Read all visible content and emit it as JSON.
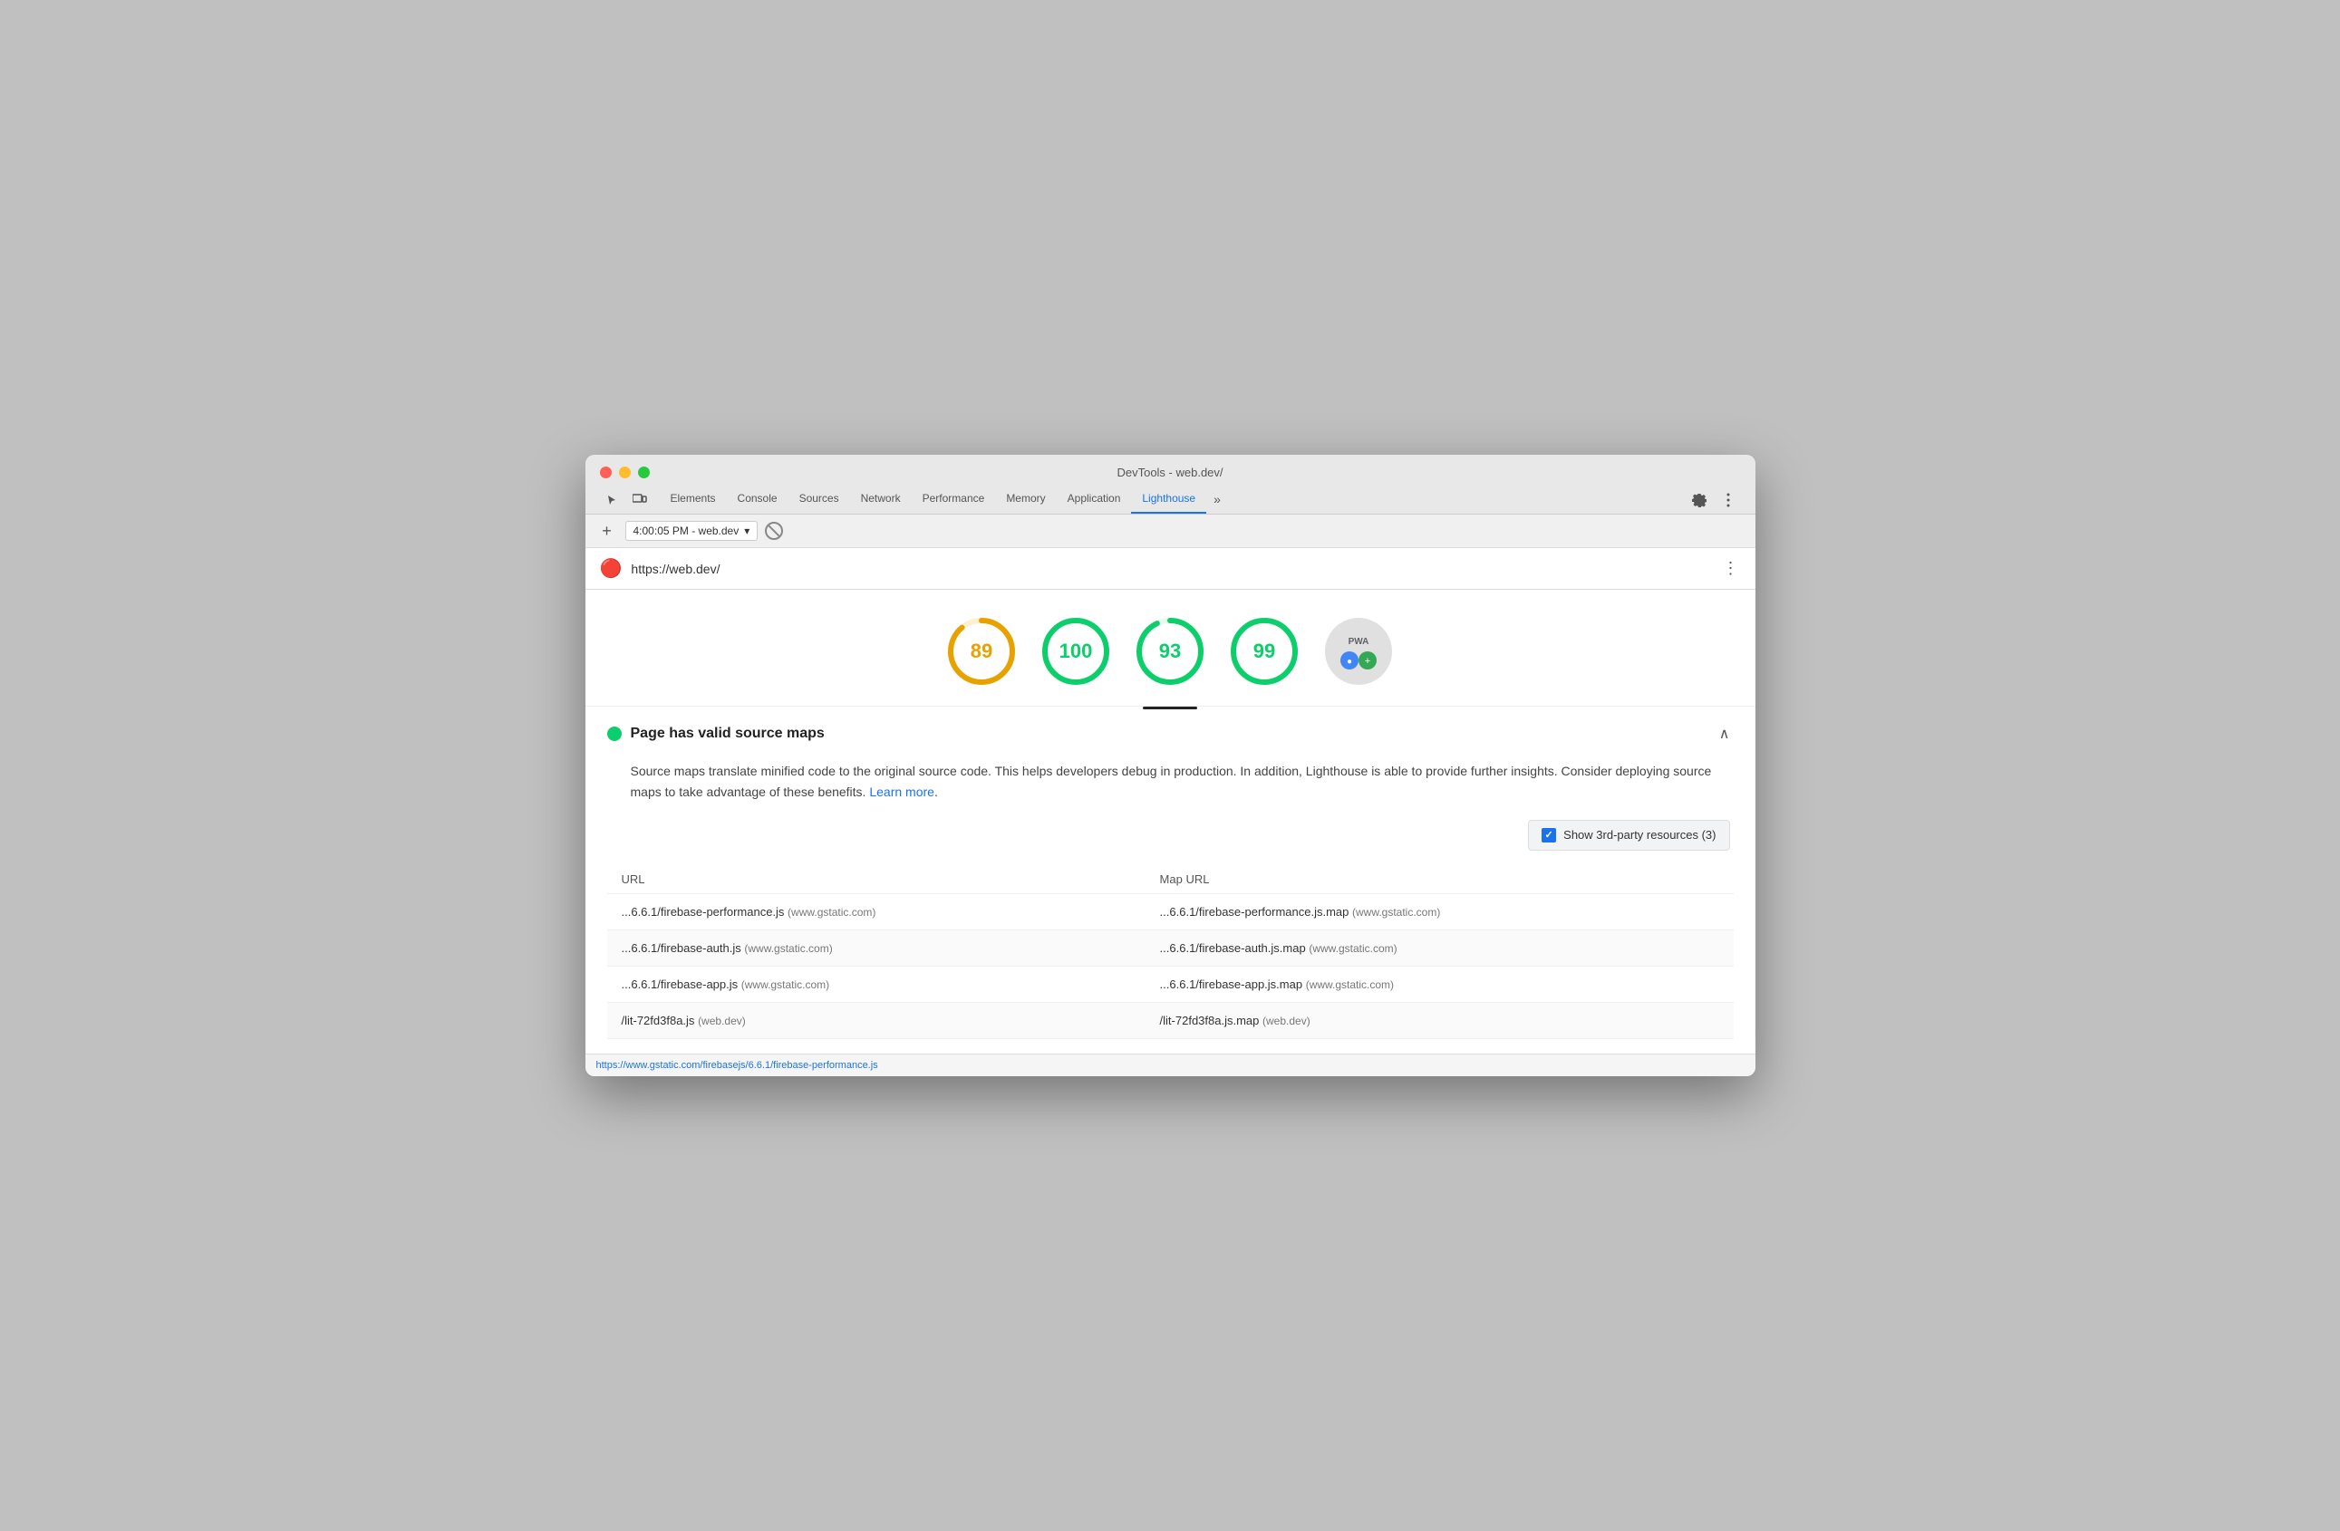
{
  "window": {
    "title": "DevTools - web.dev/"
  },
  "tabs": {
    "items": [
      {
        "id": "elements",
        "label": "Elements"
      },
      {
        "id": "console",
        "label": "Console"
      },
      {
        "id": "sources",
        "label": "Sources"
      },
      {
        "id": "network",
        "label": "Network"
      },
      {
        "id": "performance",
        "label": "Performance"
      },
      {
        "id": "memory",
        "label": "Memory"
      },
      {
        "id": "application",
        "label": "Application"
      },
      {
        "id": "lighthouse",
        "label": "Lighthouse",
        "active": true
      }
    ]
  },
  "toolbar": {
    "add_label": "+",
    "session_label": "4:00:05 PM - web.dev"
  },
  "url_bar": {
    "url": "https://web.dev/"
  },
  "scores": [
    {
      "id": "performance",
      "value": "89",
      "color": "#e8a200",
      "stroke": "#e8a200",
      "bg": "#fef0cc",
      "pct": 0.89
    },
    {
      "id": "accessibility",
      "value": "100",
      "color": "#0cce6b",
      "stroke": "#0cce6b",
      "bg": "#e6f9ef",
      "pct": 1.0
    },
    {
      "id": "best-practices",
      "value": "93",
      "color": "#0cce6b",
      "stroke": "#0cce6b",
      "bg": "#e6f9ef",
      "pct": 0.93,
      "selected": true
    },
    {
      "id": "seo",
      "value": "99",
      "color": "#0cce6b",
      "stroke": "#0cce6b",
      "bg": "#e6f9ef",
      "pct": 0.99
    }
  ],
  "audit": {
    "status": "pass",
    "title": "Page has valid source maps",
    "description": "Source maps translate minified code to the original source code. This helps developers debug in production. In addition, Lighthouse is able to provide further insights. Consider deploying source maps to take advantage of these benefits.",
    "learn_more_text": "Learn more",
    "learn_more_url": "#",
    "period": "."
  },
  "third_party": {
    "checkbox_label": "Show 3rd-party resources (3)",
    "checked": true
  },
  "table": {
    "headers": [
      "URL",
      "Map URL"
    ],
    "rows": [
      {
        "url": "...6.6.1/firebase-performance.js",
        "url_domain": "(www.gstatic.com)",
        "map_url": "...6.6.1/firebase-performance.js.map",
        "map_domain": "(www.gstatic.com)"
      },
      {
        "url": "...6.6.1/firebase-auth.js",
        "url_domain": "(www.gstatic.com)",
        "map_url": "...6.6.1/firebase-auth.js.map",
        "map_domain": "(www.gstatic.com)"
      },
      {
        "url": "...6.6.1/firebase-app.js",
        "url_domain": "(www.gstatic.com)",
        "map_url": "...6.6.1/firebase-app.js.map",
        "map_domain": "(www.gstatic.com)"
      },
      {
        "url": "/lit-72fd3f8a.js",
        "url_domain": "(web.dev)",
        "map_url": "/lit-72fd3f8a.js.map",
        "map_domain": "(web.dev)"
      }
    ]
  },
  "status_bar": {
    "url": "https://www.gstatic.com/firebasejs/6.6.1/firebase-performance.js"
  }
}
